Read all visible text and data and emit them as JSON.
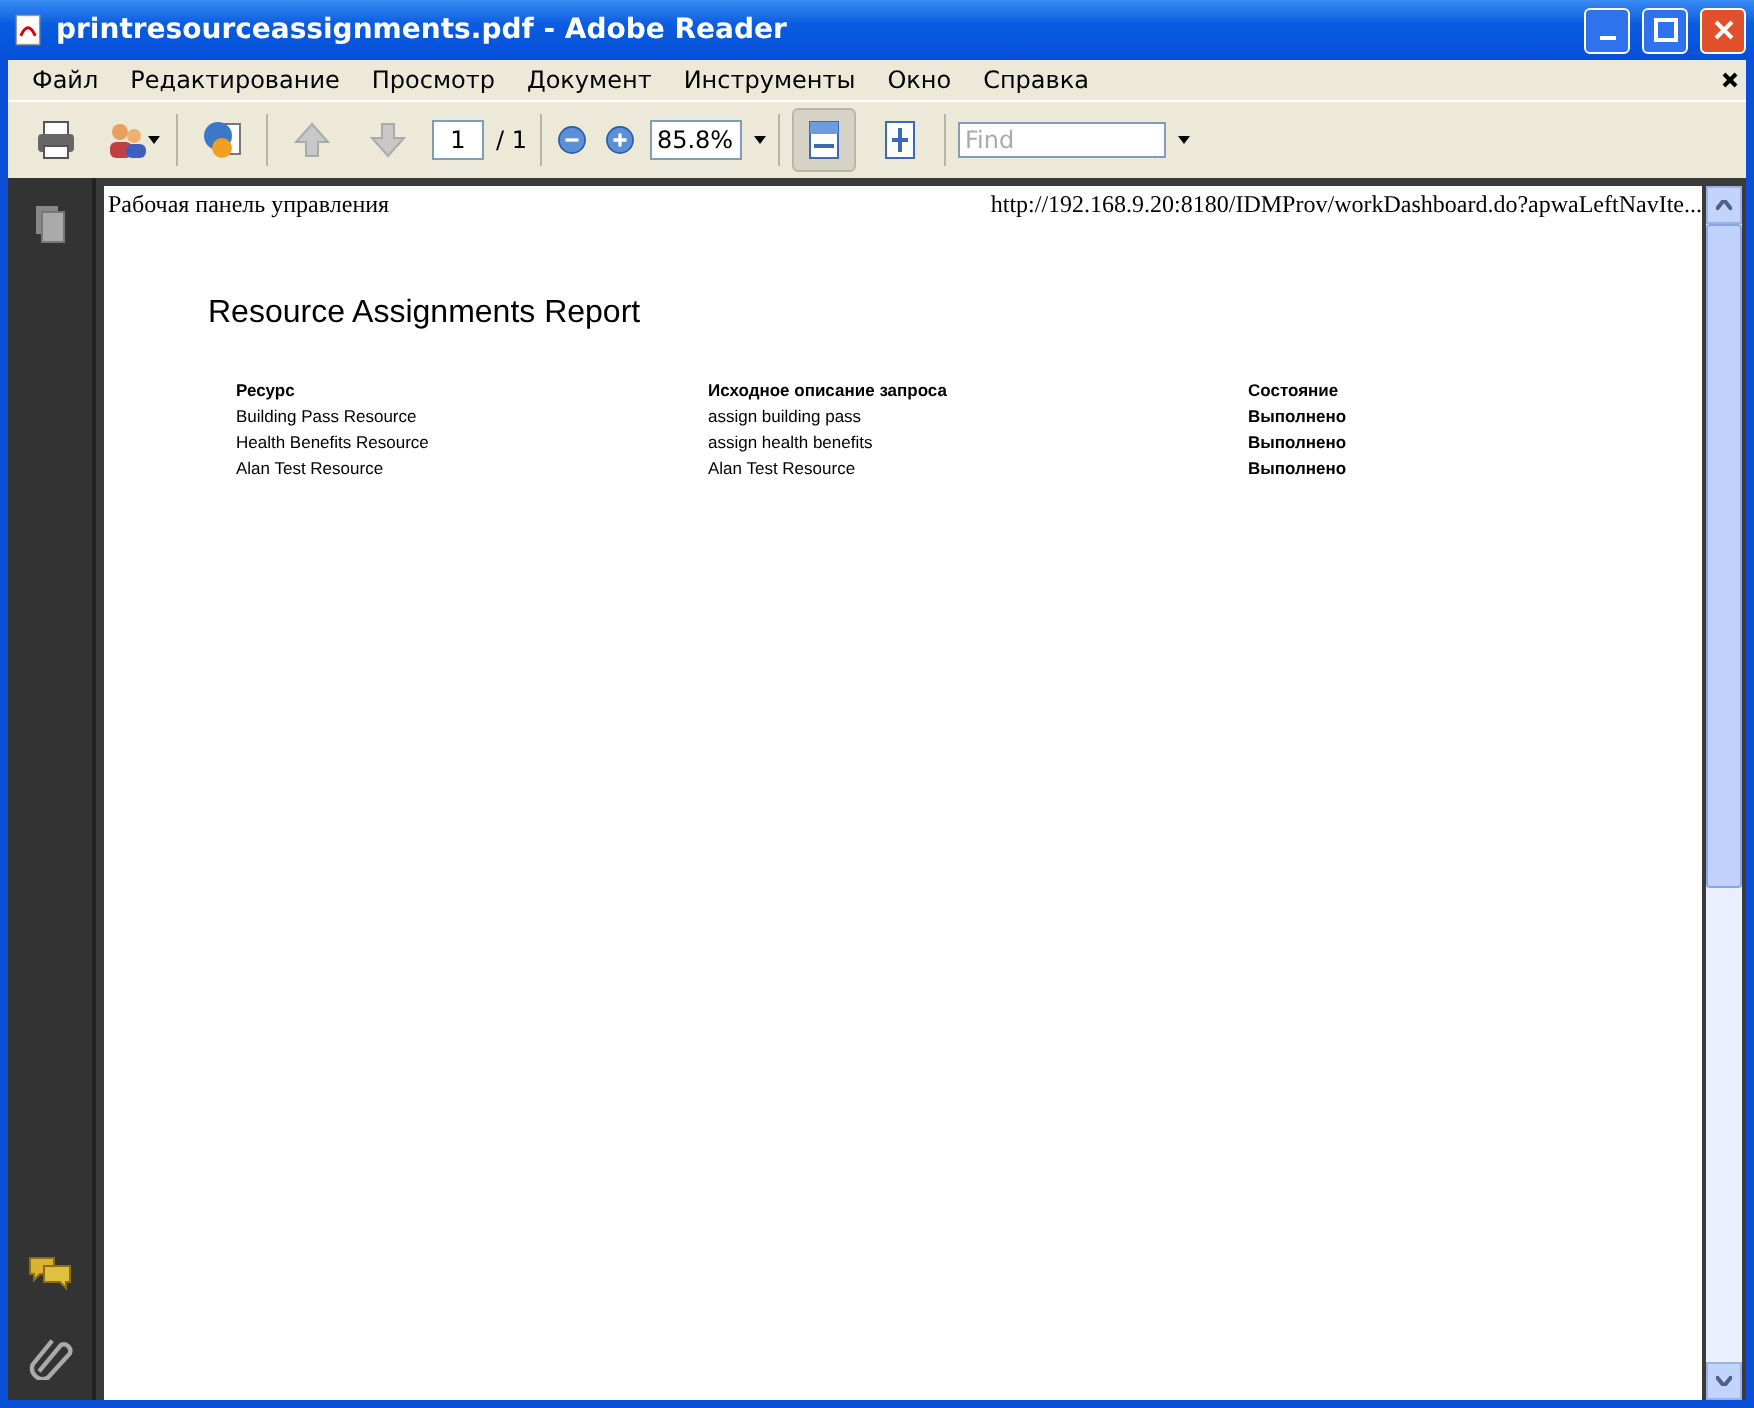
{
  "window": {
    "title": "printresourceassignments.pdf - Adobe Reader"
  },
  "menu": [
    "Файл",
    "Редактирование",
    "Просмотр",
    "Документ",
    "Инструменты",
    "Окно",
    "Справка"
  ],
  "toolbar": {
    "page": "1",
    "page_total": "/ 1",
    "zoom": "85.8%",
    "find": {
      "placeholder": "Find"
    },
    "fit_width": {
      "selected": true
    },
    "fit_page": {
      "selected": false
    }
  },
  "page": {
    "header_left": "Рабочая панель управления",
    "header_right": "http://192.168.9.20:8180/IDMProv/workDashboard.do?apwaLeftNavIte...",
    "title": "Resource Assignments Report",
    "columns": [
      "Ресурс",
      "Исходное описание запроса",
      "Состояние"
    ],
    "rows": [
      [
        "Building Pass Resource",
        "assign building pass",
        "Выполнено"
      ],
      [
        "Health Benefits Resource",
        "assign health benefits",
        "Выполнено"
      ],
      [
        "Alan Test Resource",
        "Alan Test Resource",
        "Выполнено"
      ]
    ]
  }
}
